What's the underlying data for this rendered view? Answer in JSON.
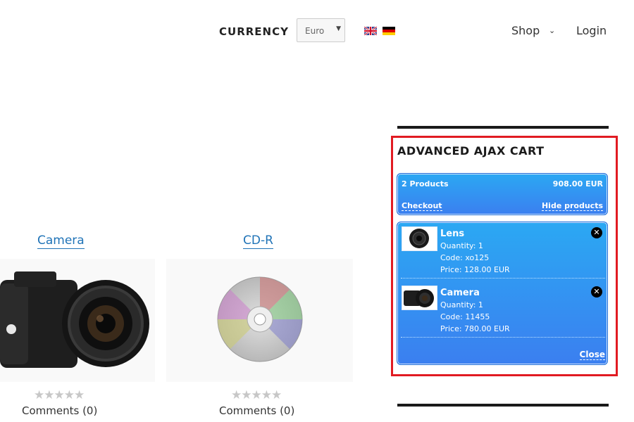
{
  "header": {
    "currency_label": "CURRENCY",
    "currency_value": "Euro",
    "languages": [
      "en-flag-icon",
      "de-flag-icon"
    ],
    "nav": {
      "shop": "Shop",
      "login": "Login"
    }
  },
  "products": [
    {
      "title": "Camera",
      "comments": "Comments (0)",
      "rating": "★★★★★"
    },
    {
      "title": "CD-R",
      "comments": "Comments (0)",
      "rating": "★★★★★"
    }
  ],
  "cart": {
    "title": "ADVANCED AJAX CART",
    "summary": {
      "count": "2 Products",
      "total": "908.00 EUR",
      "checkout": "Checkout",
      "hide": "Hide products"
    },
    "items": [
      {
        "name": "Lens",
        "quantity": "Quantity: 1",
        "code": "Code: xo125",
        "price": "Price: 128.00 EUR"
      },
      {
        "name": "Camera",
        "quantity": "Quantity: 1",
        "code": "Code: 11455",
        "price": "Price: 780.00 EUR"
      }
    ],
    "close": "Close"
  },
  "colors": {
    "accent": "#1f73b7",
    "cart_top": "#2ba8f3",
    "cart_bottom": "#3b7ff0",
    "highlight": "#e11b22"
  }
}
